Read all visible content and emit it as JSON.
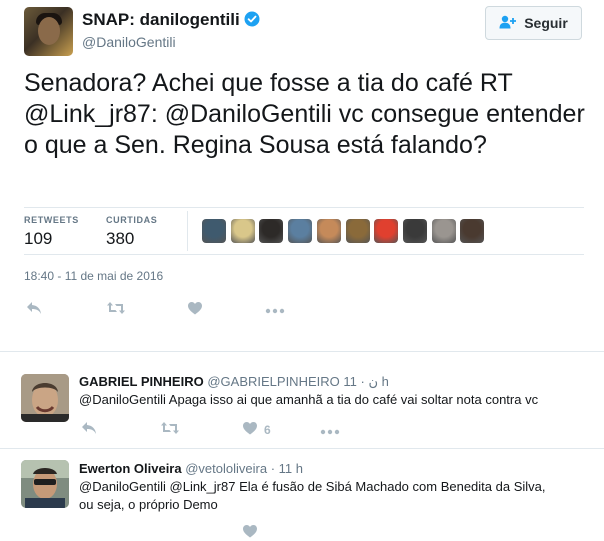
{
  "tweet": {
    "display_name": "SNAP: danilogentili",
    "username": "@DaniloGentili",
    "follow_label": "Seguir",
    "text": "Senadora? Achei que fosse a tia do café RT @Link_jr87: @DaniloGentili  vc consegue entender o que a Sen. Regina Sousa está falando?",
    "retweets_label": "RETWEETS",
    "retweets_value": "109",
    "likes_label": "CURTIDAS",
    "likes_value": "380",
    "timestamp": "18:40 - 11 de mai de 2016",
    "liker_avatar_colors": [
      "#3f5a6e",
      "#d9c78a",
      "#2d2a28",
      "#5b7fa0",
      "#c58a5a",
      "#8a6a3a",
      "#e0402f",
      "#3a3a3a",
      "#9a9590",
      "#4a3a30"
    ]
  },
  "replies": [
    {
      "name": "GABRIEL PINHEIRO",
      "username": "@GABRIELPINHEIRO",
      "symbol": "ن",
      "separator": "·",
      "time": "11 h",
      "text": "@DaniloGentili  Apaga isso ai que amanhã a tia do café vai soltar nota contra vc",
      "likes": "6"
    },
    {
      "name": "Ewerton Oliveira",
      "username": "@vetololiveira",
      "separator": "·",
      "time": "11 h",
      "text_line1": "@DaniloGentili @Link_jr87 Ela é fusão de Sibá Machado com Benedita da Silva,",
      "text_line2": "ou seja, o próprio Demo"
    }
  ],
  "colors": {
    "text": "#14171a",
    "secondary": "#657786",
    "action_icon": "#aab8c2",
    "verified": "#1da1f2",
    "follow_text": "#292f33"
  },
  "icons": [
    "verified-badge-icon",
    "add-user-icon",
    "reply-icon",
    "retweet-icon",
    "like-icon",
    "more-icon"
  ]
}
